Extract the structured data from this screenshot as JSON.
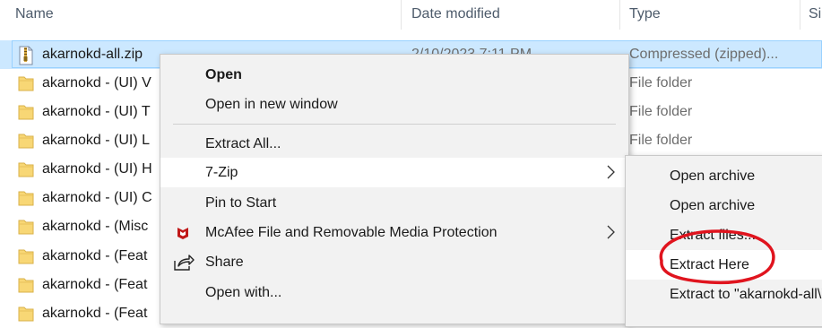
{
  "columns": {
    "name": "Name",
    "date_modified": "Date modified",
    "type": "Type",
    "size_partial": "Si"
  },
  "files": [
    {
      "name": "akarnokd-all.zip",
      "date": "2/10/2023 7:11 PM",
      "type": "Compressed (zipped)...",
      "icon": "zip-icon",
      "selected": true
    },
    {
      "name": "akarnokd - (UI) V",
      "date": "",
      "type": "File folder",
      "icon": "folder-icon"
    },
    {
      "name": "akarnokd - (UI) T",
      "date": "",
      "type": "File folder",
      "icon": "folder-icon"
    },
    {
      "name": "akarnokd - (UI) L",
      "date": "",
      "type": "File folder",
      "icon": "folder-icon"
    },
    {
      "name": "akarnokd - (UI) H",
      "date": "",
      "type": "",
      "icon": "folder-icon"
    },
    {
      "name": "akarnokd - (UI) C",
      "date": "",
      "type": "",
      "icon": "folder-icon"
    },
    {
      "name": "akarnokd - (Misc",
      "date": "",
      "type": "",
      "icon": "folder-icon"
    },
    {
      "name": "akarnokd - (Feat",
      "date": "",
      "type": "",
      "icon": "folder-icon"
    },
    {
      "name": "akarnokd - (Feat",
      "date": "",
      "type": "",
      "icon": "folder-icon"
    },
    {
      "name": "akarnokd - (Feat",
      "date": "",
      "type": "",
      "icon": "folder-icon"
    }
  ],
  "context_menu": {
    "items": [
      {
        "label": "Open",
        "bold": true
      },
      {
        "label": "Open in new window"
      },
      {
        "label": "Extract All..."
      },
      {
        "label": "7-Zip",
        "has_submenu": true,
        "hover": true
      },
      {
        "label": "Pin to Start"
      },
      {
        "label": "McAfee File and Removable Media Protection",
        "icon": "mcafee-icon",
        "has_submenu": true
      },
      {
        "label": "Share",
        "icon": "share-icon"
      },
      {
        "label": "Open with..."
      }
    ]
  },
  "submenu_7zip": {
    "items": [
      {
        "label": "Open archive"
      },
      {
        "label": "Open archive"
      },
      {
        "label": "Extract files..."
      },
      {
        "label": "Extract Here",
        "hover": true,
        "circled": true
      },
      {
        "label": "Extract to \"akarnokd-all\\\""
      }
    ]
  },
  "colors": {
    "selection_bg": "#cce8ff",
    "selection_border": "#99d1ff",
    "menu_bg": "#f2f2f2",
    "annotation_red": "#e0141e",
    "folder_yellow": "#f8d775",
    "mcafee_red": "#c01818"
  }
}
